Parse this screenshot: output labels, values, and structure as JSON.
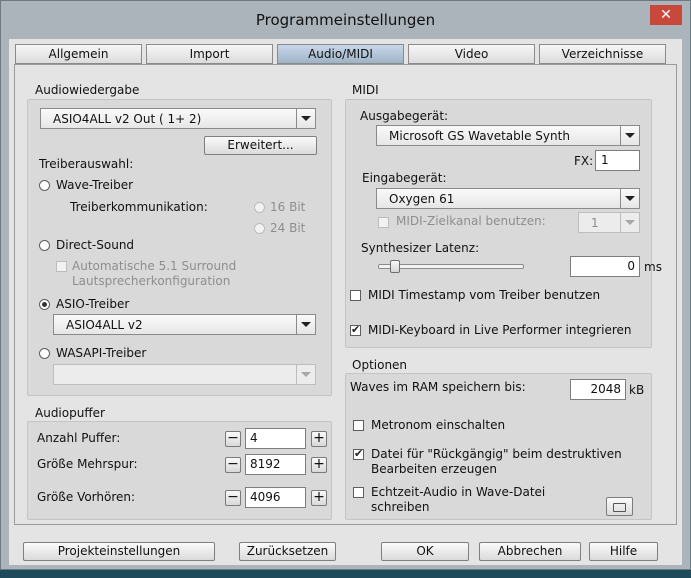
{
  "window": {
    "title": "Programmeinstellungen",
    "close_glyph": "✕"
  },
  "tabs": [
    "Allgemein",
    "Import",
    "Audio/MIDI",
    "Video",
    "Verzeichnisse"
  ],
  "active_tab": "Audio/MIDI",
  "audio_playback": {
    "label": "Audiowiedergabe",
    "device": "ASIO4ALL v2 Out ( 1+ 2)",
    "advanced_button": "Erweitert...",
    "driver_label": "Treiberauswahl:",
    "wave_driver": "Wave-Treiber",
    "driver_comm_label": "Treiberkommunikation:",
    "bit16": "16 Bit",
    "bit24": "24 Bit",
    "direct_sound": "Direct-Sound",
    "auto_surround_line1": "Automatische 5.1 Surround",
    "auto_surround_line2": "Lautsprecherkonfiguration",
    "asio_driver": "ASIO-Treiber",
    "asio_device": "ASIO4ALL v2",
    "wasapi_driver": "WASAPI-Treiber",
    "wasapi_device": "",
    "selected_driver": "ASIO-Treiber"
  },
  "audio_buffer": {
    "label": "Audiopuffer",
    "count_label": "Anzahl Puffer:",
    "count_value": "4",
    "multitrack_label": "Größe Mehrspur:",
    "multitrack_value": "8192",
    "preview_label": "Größe Vorhören:",
    "preview_value": "4096",
    "minus": "−",
    "plus": "+"
  },
  "midi": {
    "label": "MIDI",
    "output_label": "Ausgabegerät:",
    "output_device": "Microsoft GS Wavetable Synth",
    "fx_label": "FX:",
    "fx_value": "1",
    "input_label": "Eingabegerät:",
    "input_device": "Oxygen 61",
    "target_channel_label": "MIDI-Zielkanal benutzen:",
    "target_channel_value": "1",
    "latency_label": "Synthesizer Latenz:",
    "latency_value": "0",
    "latency_unit": "ms",
    "timestamp_label": "MIDI Timestamp vom Treiber benutzen",
    "timestamp_checked": false,
    "keyboard_label": "MIDI-Keyboard in Live Performer integrieren",
    "keyboard_checked": true
  },
  "options": {
    "label": "Optionen",
    "waves_ram_label": "Waves im RAM speichern bis:",
    "waves_ram_value": "2048",
    "waves_ram_unit": "kB",
    "metronome_label": "Metronom einschalten",
    "metronome_checked": false,
    "undo_line1": "Datei für \"Rückgängig\" beim destruktiven",
    "undo_line2": "Bearbeiten erzeugen",
    "undo_checked": true,
    "realtime_line1": "Echtzeit-Audio in Wave-Datei",
    "realtime_line2": "schreiben",
    "realtime_checked": false
  },
  "footer": {
    "project_settings": "Projekteinstellungen",
    "reset": "Zurücksetzen",
    "ok": "OK",
    "cancel": "Abbrechen",
    "help": "Hilfe"
  }
}
